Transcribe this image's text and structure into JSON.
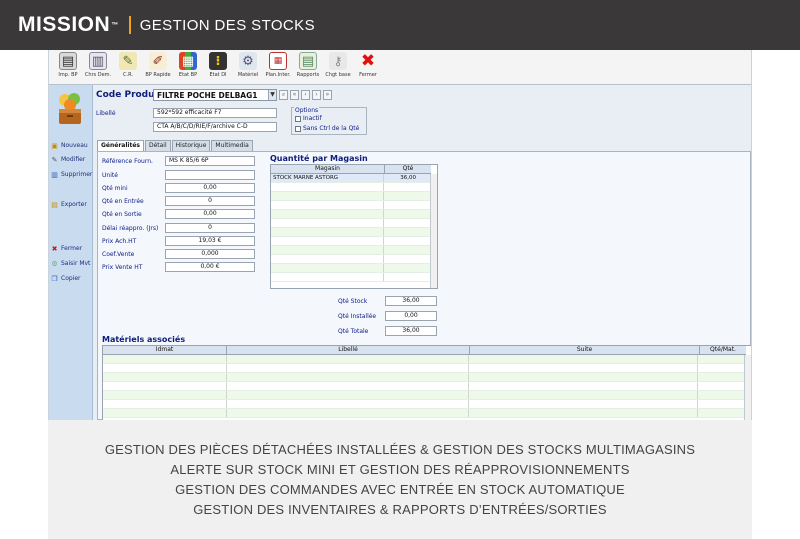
{
  "header": {
    "brand": "MISSION",
    "tm": "™",
    "title": "GESTION DES STOCKS"
  },
  "toolbar": {
    "items": [
      "Imp. BP",
      "Chrs Dem.",
      "C.R.",
      "BP Rapide",
      "Etat BP",
      "Etat DI",
      "Matériel",
      "Plan.Inter.",
      "Rapports",
      "Chgt base",
      "Fermer"
    ]
  },
  "sidebar": {
    "items": [
      "Nouveau",
      "Modifier",
      "Supprimer",
      "Exporter",
      "Fermer",
      "Saisir Mvt",
      "Copier"
    ]
  },
  "form": {
    "code_label": "Code Produit",
    "code_value": "FILTRE POCHE DELBAG1",
    "libelle_label": "Libellé",
    "libelle_1": "592*592 efficacité F7",
    "libelle_2": "CTA A/B/C/D/RIE/F/archive C-D",
    "options_title": "Options",
    "opt_inactif": "Inactif",
    "opt_sans_ctrl": "Sans Ctrl de la Qté"
  },
  "tabs": [
    "Généralités",
    "Détail",
    "Historique",
    "Multimedia"
  ],
  "fields": [
    {
      "label": "Référence Fourn.",
      "value": "MS K 85/6 6P"
    },
    {
      "label": "Unité",
      "value": ""
    },
    {
      "label": "Qté mini",
      "value": "0,00"
    },
    {
      "label": "Qté en Entrée",
      "value": "0"
    },
    {
      "label": "Qté en Sortie",
      "value": "0,00"
    },
    {
      "label": "Délai réappro. (Jrs)",
      "value": "0"
    },
    {
      "label": "Prix Ach.HT",
      "value": "19,03 €"
    },
    {
      "label": "Coef.Vente",
      "value": "0,000"
    },
    {
      "label": "Prix Vente HT",
      "value": "0,00 €"
    }
  ],
  "magasin": {
    "title": "Quantité par Magasin",
    "col_magasin": "Magasin",
    "col_qte": "Qté",
    "row_magasin": "STOCK MARNE ASTORG",
    "row_qte": "36,00"
  },
  "totals": [
    {
      "label": "Qté Stock",
      "value": "36,00"
    },
    {
      "label": "Qté Installée",
      "value": "0,00"
    },
    {
      "label": "Qté Totale",
      "value": "36,00"
    }
  ],
  "materiels": {
    "title": "Matériels associés",
    "columns": [
      "Idmat",
      "Libellé",
      "Suite",
      "Qté/Mat."
    ]
  },
  "footer": {
    "lines": [
      "GESTION DES PIÈCES DÉTACHÉES INSTALLÉES & GESTION DES STOCKS MULTIMAGASINS",
      "ALERTE SUR STOCK MINI ET GESTION DES RÉAPPROVISIONNEMENTS",
      "GESTION DES COMMANDES AVEC ENTRÉE EN STOCK AUTOMATIQUE",
      "GESTION DES INVENTAIRES & RAPPORTS D’ENTRÉES/SORTIES"
    ]
  }
}
